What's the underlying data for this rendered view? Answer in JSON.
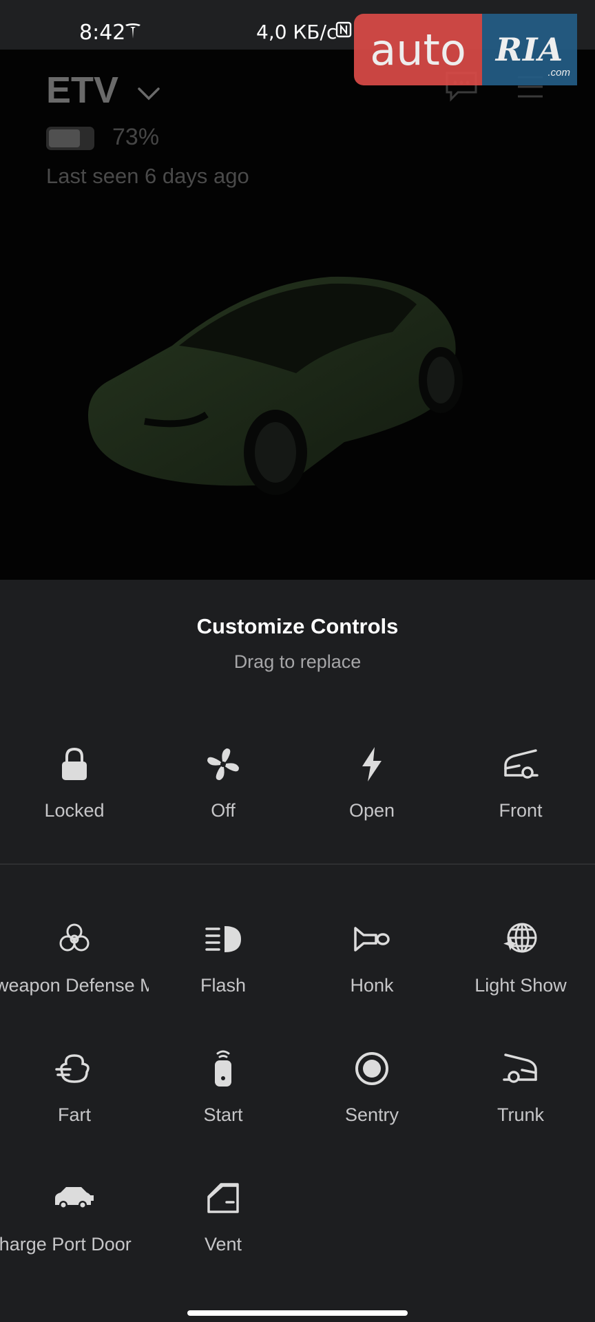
{
  "status_bar": {
    "time": "8:42",
    "network_speed": "4,0 КБ/с",
    "icons": [
      "tesla-icon",
      "nfc-icon",
      "bluetooth-icon",
      "alarm-icon",
      "signal-icon",
      "volte-icon",
      "4g-signal-icon",
      "battery-icon"
    ]
  },
  "watermark": {
    "auto": "auto",
    "ria": "RIA",
    "com": ".com"
  },
  "vehicle": {
    "name": "ETV",
    "battery_percent": 73,
    "battery_label": "73%",
    "last_seen": "Last seen 6 days ago"
  },
  "sheet": {
    "title": "Customize Controls",
    "subtitle": "Drag to replace",
    "pinned_controls": [
      {
        "label": "Locked",
        "icon": "lock-icon"
      },
      {
        "label": "Off",
        "icon": "fan-icon"
      },
      {
        "label": "Open",
        "icon": "lightning-icon"
      },
      {
        "label": "Front",
        "icon": "frunk-icon"
      }
    ],
    "available_controls": [
      {
        "label": "Bioweapon Defense Mode",
        "icon": "biohazard-icon"
      },
      {
        "label": "Flash",
        "icon": "headlight-icon"
      },
      {
        "label": "Honk",
        "icon": "horn-icon"
      },
      {
        "label": "Light Show",
        "icon": "disco-ball-icon"
      },
      {
        "label": "Fart",
        "icon": "fart-icon"
      },
      {
        "label": "Start",
        "icon": "key-fob-icon"
      },
      {
        "label": "Sentry",
        "icon": "sentry-icon"
      },
      {
        "label": "Trunk",
        "icon": "trunk-icon"
      },
      {
        "label": "Charge Port Door",
        "icon": "charge-port-icon"
      },
      {
        "label": "Vent",
        "icon": "vent-window-icon"
      }
    ]
  },
  "colors": {
    "sheet_bg": "#1d1e20",
    "hero_bg": "#030303",
    "car_tint": "#1e2b18",
    "label": "#c6c6c8",
    "watermark_red": "#d94b47",
    "watermark_blue": "#245d86"
  }
}
